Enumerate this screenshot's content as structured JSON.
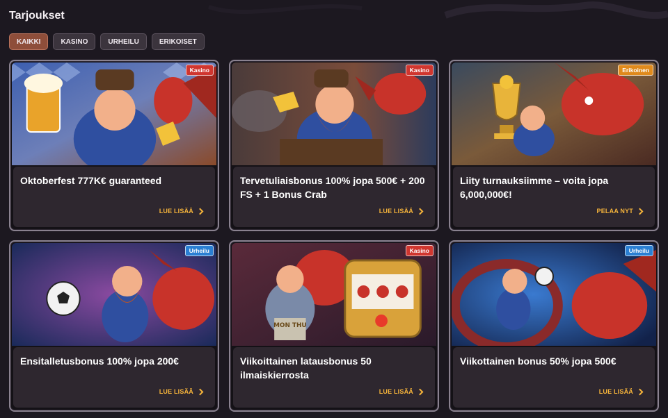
{
  "page": {
    "title": "Tarjoukset"
  },
  "tabs": [
    {
      "label": "KAIKKI",
      "active": true
    },
    {
      "label": "KASINO",
      "active": false
    },
    {
      "label": "URHEILU",
      "active": false
    },
    {
      "label": "ERIKOISET",
      "active": false
    }
  ],
  "cards": [
    {
      "badge": "Kasino",
      "badge_type": "kasino",
      "title": "Oktoberfest 777K€ guaranteed",
      "cta": "LUE LISÄÄ",
      "art": "oktoberfest"
    },
    {
      "badge": "Kasino",
      "badge_type": "kasino",
      "title": "Tervetuliaisbonus 100% jopa 500€ + 200 FS + 1 Bonus Crab",
      "cta": "LUE LISÄÄ",
      "art": "mine"
    },
    {
      "badge": "Erikoinen",
      "badge_type": "erikoinen",
      "title": "Liity turnauksiimme – voita jopa 6,000,000€!",
      "cta": "PELAA NYT",
      "art": "trophy"
    },
    {
      "badge": "Urheilu",
      "badge_type": "urheilu",
      "title": "Ensitalletusbonus 100% jopa 200€",
      "cta": "LUE LISÄÄ",
      "art": "football"
    },
    {
      "badge": "Kasino",
      "badge_type": "kasino",
      "title": "Viikoittainen latausbonus 50 ilmaiskierrosta",
      "cta": "LUE LISÄÄ",
      "art": "slot",
      "art_text": "MON THU"
    },
    {
      "badge": "Urheilu",
      "badge_type": "urheilu",
      "title": "Viikottainen bonus 50% jopa 500€",
      "cta": "LUE LISÄÄ",
      "art": "dragon-ball"
    }
  ],
  "colors": {
    "accent": "#f6b43b",
    "active_tab": "#8e4e3a",
    "kasino": "#d0362f",
    "urheilu": "#2a7fd3",
    "erikoinen": "#e08a1c"
  }
}
